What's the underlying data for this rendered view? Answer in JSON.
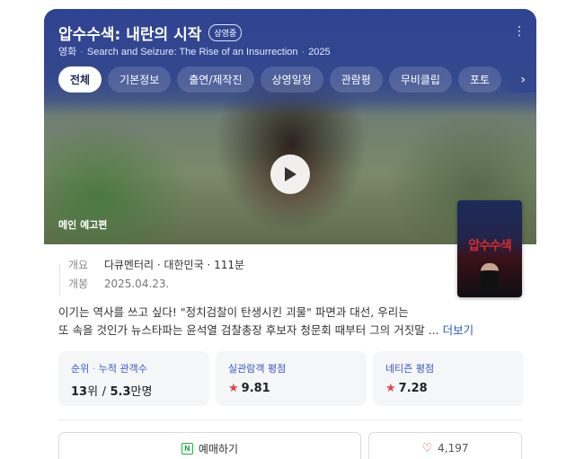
{
  "header": {
    "title": "압수수색: 내란의 시작",
    "status_badge": "상영중",
    "meta": {
      "genre": "영화",
      "english_title": "Search and Seizure: The Rise of an Insurrection",
      "year": "2025",
      "separator": "·"
    },
    "more_icon": "⋮"
  },
  "tabs": [
    {
      "label": "전체",
      "active": true
    },
    {
      "label": "기본정보"
    },
    {
      "label": "출연/제작진"
    },
    {
      "label": "상영일정"
    },
    {
      "label": "관람평"
    },
    {
      "label": "무비클립"
    },
    {
      "label": "포토"
    }
  ],
  "tabs_next_icon": "›",
  "video": {
    "label": "메인 예고편",
    "play_icon": "play-icon"
  },
  "poster": {
    "title_text": "압수수색"
  },
  "info": {
    "overview_label": "개요",
    "overview_value": "다큐멘터리 · 대한민국 · 111분",
    "release_label": "개봉",
    "release_value": "2025.04.23."
  },
  "synopsis": {
    "line1": "이기는 역사를 쓰고 싶다! \"정치검찰이 탄생시킨 괴물\" 파면과 대선, 우리는",
    "line2": "또 속을 것인가 뉴스타파는 윤석열 검찰총장 후보자 청문회 때부터 그의 거짓말 ...",
    "more_label": "더보기"
  },
  "stats": {
    "rank": {
      "label_main": "순위",
      "label_sep": "·",
      "label_sub": "누적 관객수",
      "rank_value": "13",
      "rank_unit": "위",
      "slash": "/",
      "audience_value": "5.3",
      "audience_unit": "만명"
    },
    "audience_rating": {
      "label": "실관람객 평점",
      "star": "★",
      "value": "9.81"
    },
    "netizen_rating": {
      "label": "네티즌 평점",
      "star": "★",
      "value": "7.28"
    }
  },
  "actions": {
    "buy_icon": "N",
    "buy_label": "예매하기",
    "like_icon": "♡",
    "like_count": "4,197"
  },
  "colors": {
    "header_bg": "#33478f",
    "accent_blue": "#3a56c5",
    "star_red": "#e2434b",
    "naver_green": "#1fae4d"
  }
}
